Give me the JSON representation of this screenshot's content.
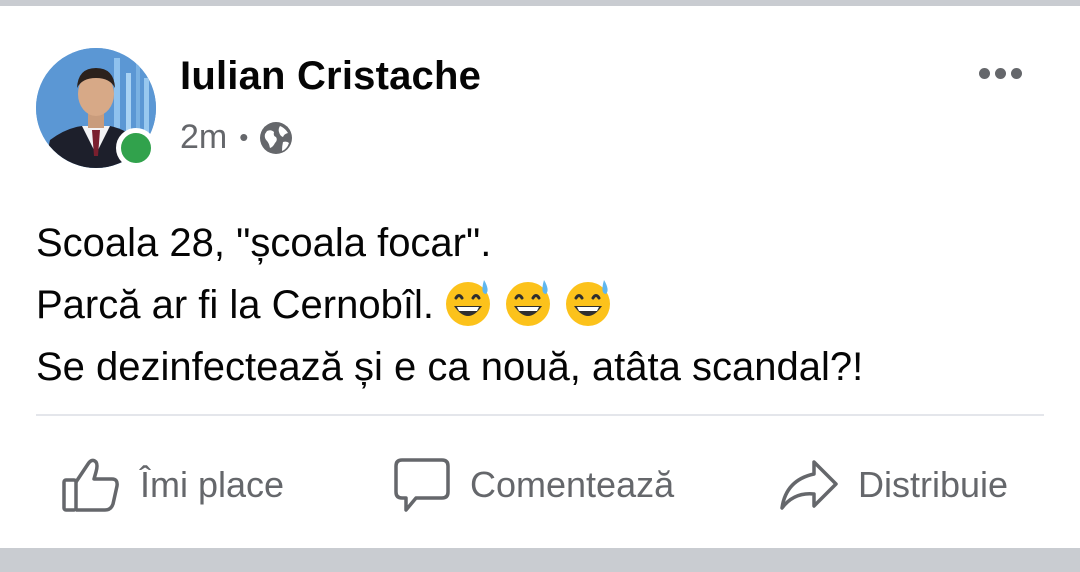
{
  "post": {
    "author_name": "Iulian Cristache",
    "time_ago": "2m",
    "separator": "•",
    "privacy_icon": "globe-icon",
    "online_status_color": "#31a24c",
    "more_icon": "more-horizontal-icon",
    "text_lines": [
      "Scoala 28, \"școala focar\".",
      "Parcă ar fi la Cernobîl.",
      "Se dezinfectează și e ca nouă, atâta scandal?!"
    ],
    "emoji_name": "grinning-face-with-sweat-emoji",
    "emoji_count": 3
  },
  "actions": {
    "like_label": "Îmi place",
    "comment_label": "Comentează",
    "share_label": "Distribuie"
  },
  "colors": {
    "text_primary": "#050505",
    "text_secondary": "#65676b",
    "divider": "#e4e6eb",
    "background": "#c9ccd1"
  }
}
